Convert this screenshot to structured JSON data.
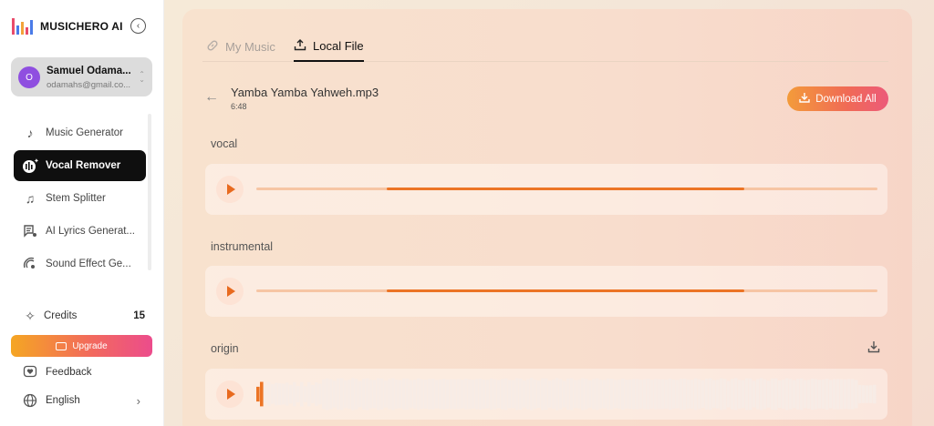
{
  "app": {
    "brand": "MUSICHERO AI"
  },
  "user": {
    "initial": "O",
    "name": "Samuel Odama...",
    "email": "odamahs@gmail.co..."
  },
  "sidebar": {
    "items": [
      {
        "label": "Music Generator",
        "icon": "music-note-icon",
        "active": false
      },
      {
        "label": "Vocal Remover",
        "icon": "vocal-remover-icon",
        "active": true
      },
      {
        "label": "Stem Splitter",
        "icon": "stem-splitter-icon",
        "active": false
      },
      {
        "label": "AI Lyrics Generat...",
        "icon": "lyrics-icon",
        "active": false
      },
      {
        "label": "Sound Effect Ge...",
        "icon": "sound-effect-icon",
        "active": false
      }
    ],
    "credits_label": "Credits",
    "credits_count": "15",
    "upgrade_label": "Upgrade",
    "feedback_label": "Feedback",
    "language_label": "English"
  },
  "main": {
    "tabs": [
      {
        "label": "My Music",
        "active": false
      },
      {
        "label": "Local File",
        "active": true
      }
    ],
    "file": {
      "name": "Yamba Yamba Yahweh.mp3",
      "duration": "6:48"
    },
    "download_all_label": "Download All",
    "tracks": [
      {
        "label": "vocal",
        "type": "bar",
        "played_start": 0.21,
        "played_end": 0.785
      },
      {
        "label": "instrumental",
        "type": "bar",
        "played_start": 0.21,
        "played_end": 0.785
      },
      {
        "label": "origin",
        "type": "waveform",
        "progress": 0.01
      }
    ]
  },
  "colors": {
    "accent": "#ec7425",
    "accent_light": "#f6c5a4",
    "active_nav_bg": "#0f0f0f",
    "avatar_bg": "#8f4fe0",
    "gradient_start": "#f5a623",
    "gradient_end": "#ec4c8c"
  }
}
